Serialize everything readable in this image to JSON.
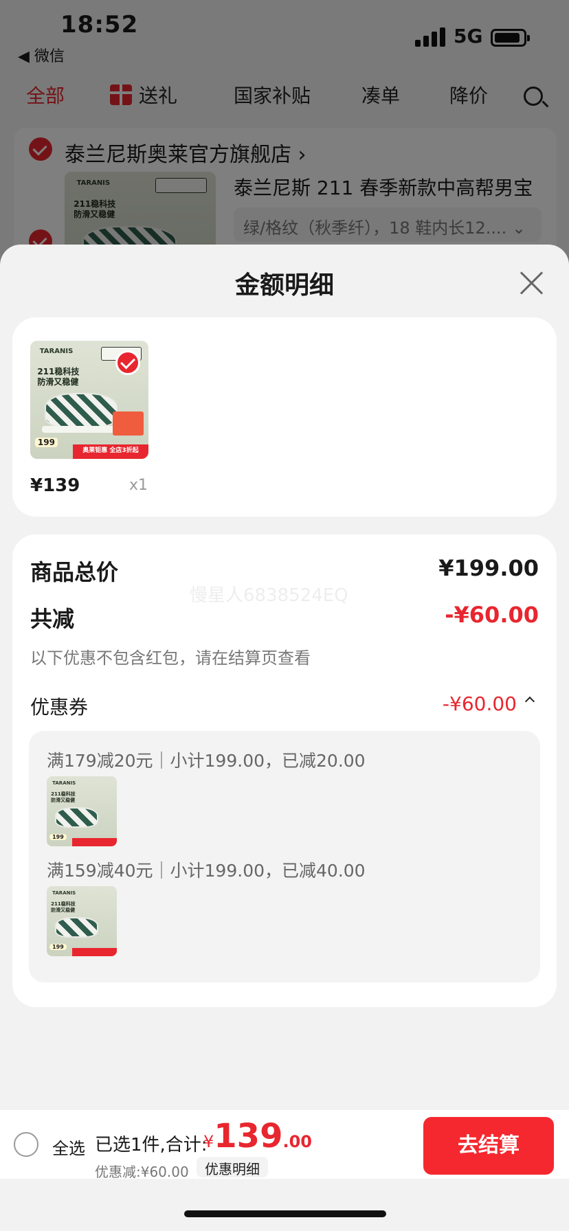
{
  "status_bar": {
    "time": "18:52",
    "back_app": "◀ 微信",
    "network": "5G"
  },
  "top_tabs": [
    {
      "label": "全部",
      "active": true
    },
    {
      "label": "送礼",
      "icon": "gift-icon"
    },
    {
      "label": "国家补贴"
    },
    {
      "label": "凑单"
    },
    {
      "label": "降价"
    }
  ],
  "store": {
    "name": "泰兰尼斯奥莱官方旗舰店",
    "chevron": "›",
    "product_title": "泰兰尼斯 211 春季新款中高帮男宝",
    "sku": "绿/格纹（秋季纤），18 鞋内长12....",
    "sku_chevron": "⌄"
  },
  "product_image": {
    "brand": "TARANIS",
    "slogan_1": "211稳科技",
    "slogan_2": "防滑又稳健",
    "price": "199",
    "promo": "奥莱钜惠 全店3折起"
  },
  "sheet": {
    "title": "金额明细",
    "item": {
      "price": "¥139",
      "qty": "x1"
    },
    "summary": {
      "total_label": "商品总价",
      "total_value": "¥199.00",
      "reduce_label": "共减",
      "reduce_value": "-¥60.00",
      "note": "以下优惠不包含红包，请在结算页查看",
      "coupon_label": "优惠券",
      "coupon_value": "-¥60.00",
      "coupon_lines": [
        "满179减20元｜小计199.00，已减20.00",
        "满159减40元｜小计199.00，已减40.00"
      ]
    },
    "watermark": "慢星人6838524EQ"
  },
  "bottom_bar": {
    "select_all": "全选",
    "selected_text": "已选1件,合计:",
    "currency": "¥",
    "amount_int": "139",
    "amount_dec": ".00",
    "discount_text": "优惠减:¥60.00",
    "detail_tag": "优惠明细",
    "checkout": "去结算"
  },
  "colors": {
    "accent": "#e8262f",
    "checkout": "#f5282f"
  }
}
